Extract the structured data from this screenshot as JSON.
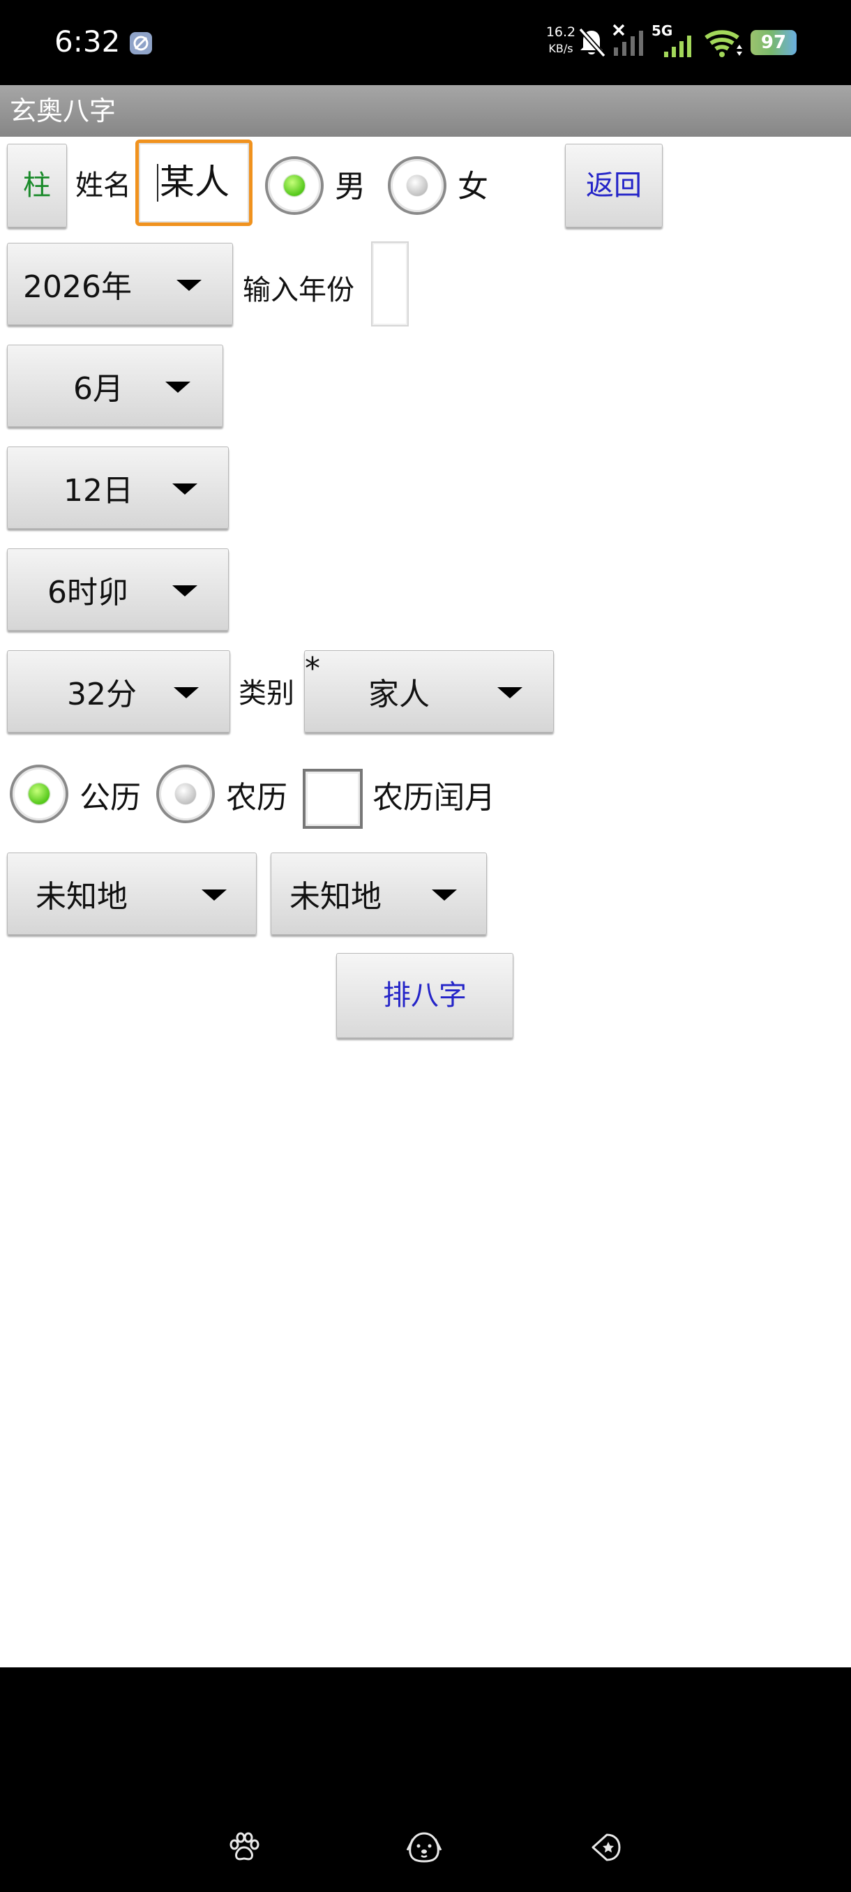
{
  "status_bar": {
    "time": "6:32",
    "speed_value": "16.2",
    "speed_unit": "KB/s",
    "network_type": "5G",
    "battery_level": "97",
    "icons": [
      "app-notification-icon",
      "mute-icon",
      "no-sim-signal-icon",
      "signal-icon",
      "wifi-icon",
      "battery-icon"
    ]
  },
  "app": {
    "title": "玄奥八字"
  },
  "form": {
    "pillar_button": "柱",
    "name_label": "姓名",
    "name_value": "某人",
    "gender": {
      "male": "男",
      "female": "女",
      "selected": "male"
    },
    "back_button": "返回",
    "year_value": "2026年",
    "year_input_label": "输入年份",
    "year_input_value": "",
    "month_value": "6月",
    "day_value": "12日",
    "hour_value": "6时卯",
    "minute_value": "32分",
    "category_label": "类别",
    "category_value": "家人",
    "calendar": {
      "solar": "公历",
      "lunar": "农历",
      "selected": "solar"
    },
    "leap_month_label": "农历闰月",
    "leap_month_checked": false,
    "place_1_value": "未知地",
    "place_2_value": "未知地",
    "submit_button": "排八字"
  },
  "colors": {
    "pillar_text": "#1a8a2a",
    "link_button_text": "#2424c8",
    "focus_border": "#f0921e",
    "title_bar": "#969696"
  },
  "nav_bar": {
    "icons": [
      "paw-icon",
      "dog-face-icon",
      "star-back-icon"
    ]
  }
}
